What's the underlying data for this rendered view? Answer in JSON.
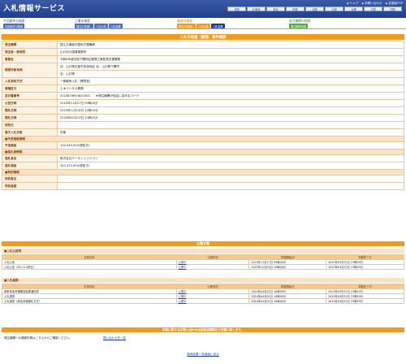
{
  "header": {
    "title": "入札情報サービス",
    "links": [
      "ヘルプ",
      "お問い合わせ",
      "全国版TOP"
    ],
    "regions": [
      "全国",
      "北海道",
      "東北",
      "関東",
      "北陸",
      "中部",
      "近畿",
      "中国",
      "四国",
      "九州・沖縄"
    ]
  },
  "nav": {
    "groups": [
      {
        "label": "今回案件の検索",
        "buttons": [
          "今回案件の検索"
        ]
      },
      {
        "label": "工事の検索",
        "buttons": [
          "発注の見通し",
          "入札公告",
          "入札結果"
        ]
      },
      {
        "label": "業務の検索",
        "buttons": [
          "発注の見通し",
          "入札公告",
          "入札結果"
        ]
      },
      {
        "label": "発注機関の検索",
        "buttons": [
          "発注機関情報"
        ]
      }
    ]
  },
  "main": {
    "title": "入札の経過（業務）案件概要",
    "rows": [
      {
        "k": "発注機関",
        "v": "国土交通省中国地方整備局"
      },
      {
        "k": "発注者・部局等",
        "v": "山口河川国道事務所"
      },
      {
        "k": "業務名",
        "v": "令和6年度宇部下関地区管理工事監督支援業務"
      },
      {
        "k": "業務対象地域",
        "v": "自：山口県宇部市床波地区 至：山口県下関市",
        "v2": "至：山口県"
      },
      {
        "k": "入札契約方式",
        "v": "一般競争入札（標準型）"
      },
      {
        "k": "業種区分",
        "v": "土木コンサル業務"
      },
      {
        "k": "設計書番号",
        "v": "2024876654820003　　★発注機関が独自に定めるコード"
      },
      {
        "k": "公告日時",
        "v": "2023年11月27日 09時00分"
      },
      {
        "k": "開札日時",
        "v": "2023年12月18日 12時00分"
      },
      {
        "k": "開札日時",
        "v": "2024年02月19日 13時00分"
      },
      {
        "k": "契約日",
        "v": ""
      },
      {
        "k": "電子入札対象",
        "v": "対象"
      }
    ],
    "section_estimate": "■予定価格情報",
    "estimate_rows": [
      {
        "k": "予定価格",
        "v": "130,040,000(税抜き)"
      }
    ],
    "section_winner": "■落札者情報",
    "winner_rows": [
      {
        "k": "落札者名",
        "v": "株式会社テーネットジャパン"
      },
      {
        "k": "落札価格",
        "v": "104,310,000(税抜き)"
      }
    ],
    "section_contract": "■契約情報",
    "contract_rows": [
      {
        "k": "契約者名",
        "v": ""
      },
      {
        "k": "契約金額",
        "v": ""
      }
    ]
  },
  "documents": {
    "title": "公開文書",
    "columns": [
      "文書名称",
      "公開状況",
      "掲載開始日",
      "掲載終了日"
    ],
    "public_notice": {
      "label": "■入札公告等",
      "rows": [
        {
          "name": "入札公告",
          "status": "公開中",
          "start": "2023年11月27日 09時00分",
          "end": "2025年03月31日 23時59分"
        },
        {
          "name": "入札公告（R5.12.4修正）",
          "status": "公開中",
          "start": "2023年12月04日 10時00分",
          "end": "2025年03月31日 23時59分"
        }
      ]
    },
    "results": {
      "label": "■入札結果",
      "rows": [
        {
          "name": "競争参加資格確認結果通知書",
          "status": "公開中",
          "start": "2024年04月01日 10時00分",
          "end": "2025年03月31日 23時59分"
        },
        {
          "name": "入札調書",
          "status": "公開中",
          "start": "2024年04月01日 10時00分",
          "end": "2025年03月31日 23時59分"
        },
        {
          "name": "入札調書（総合評価落札方式）",
          "status": "公開中",
          "start": "2024年04月01日 10時00分",
          "end": "2025年03月31日 23時59分"
        }
      ]
    }
  },
  "inquiry": {
    "title": "内容に関するお問い合わせは各発注機関までお願い致します。",
    "text": "発注機関への連絡先等はこちらからご確認ください。",
    "link": "問い合わせ先一覧"
  },
  "back_link": "検索結果一覧画面に戻る"
}
